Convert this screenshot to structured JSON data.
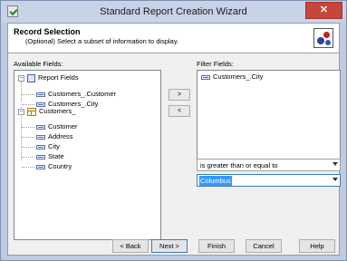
{
  "window": {
    "title": "Standard Report Creation Wizard",
    "close_label": "✕"
  },
  "header": {
    "title": "Record Selection",
    "subtitle": "(Optional)  Select a subset of information to display."
  },
  "available": {
    "label": "Available Fields:",
    "tree": [
      {
        "label": "Report Fields",
        "type": "group",
        "expander": "−",
        "children": [
          "Customers_.Customer",
          "Customers_.City"
        ]
      },
      {
        "label": "Customers_",
        "type": "table",
        "expander": "−",
        "children": [
          "Customer",
          "Address",
          "City",
          "State",
          "Country"
        ]
      }
    ]
  },
  "move_buttons": {
    "add": ">",
    "remove": "<"
  },
  "filter": {
    "label": "Filter Fields:",
    "items": [
      "Customers_.City"
    ],
    "operator": "is greater than or equal to",
    "value": "Columbus"
  },
  "footer": {
    "back": "< Back",
    "next": "Next >",
    "finish": "Finish",
    "cancel": "Cancel",
    "help": "Help"
  }
}
